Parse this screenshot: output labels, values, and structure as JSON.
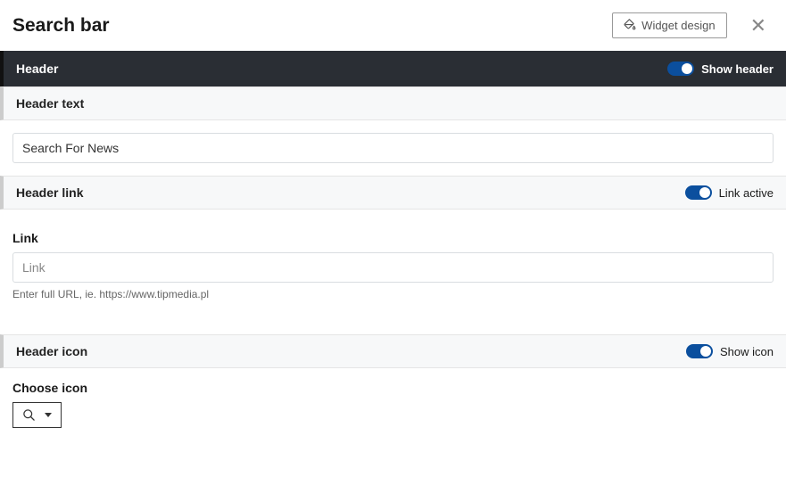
{
  "titlebar": {
    "title": "Search bar",
    "widget_design_label": "Widget design"
  },
  "header_section": {
    "label": "Header",
    "toggle_label": "Show header"
  },
  "header_text": {
    "label": "Header text",
    "value": "Search For News"
  },
  "header_link": {
    "label": "Header link",
    "toggle_label": "Link active",
    "link_field_label": "Link",
    "link_placeholder": "Link",
    "helper": "Enter full URL, ie. https://www.tipmedia.pl"
  },
  "header_icon": {
    "label": "Header icon",
    "toggle_label": "Show icon",
    "choose_label": "Choose icon"
  }
}
